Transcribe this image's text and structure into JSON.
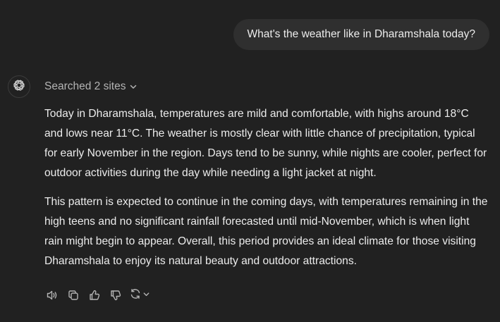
{
  "user_message": {
    "text": "What's the weather like in Dharamshala today?"
  },
  "assistant": {
    "avatar_icon": "openai-logo-icon",
    "searched": {
      "label": "Searched 2 sites",
      "icon": "chevron-down-icon"
    },
    "paragraphs": [
      "Today in Dharamshala, temperatures are mild and comfortable, with highs around 18°C and lows near 11°C. The weather is mostly clear with little chance of precipitation, typical for early November in the region. Days tend to be sunny, while nights are cooler, perfect for outdoor activities during the day while needing a light jacket at night.",
      "This pattern is expected to continue in the coming days, with temperatures remaining in the high teens and no significant rainfall forecasted until mid-November, which is when light rain might begin to appear. Overall, this period provides an ideal climate for those visiting Dharamshala to enjoy its natural beauty and outdoor attractions."
    ],
    "actions": [
      {
        "icon": "speaker-icon"
      },
      {
        "icon": "copy-icon"
      },
      {
        "icon": "thumbs-up-icon"
      },
      {
        "icon": "thumbs-down-icon"
      },
      {
        "icon": "regenerate-icon"
      }
    ]
  },
  "colors": {
    "background": "#212121",
    "user_bubble": "#2f2f2f",
    "text": "#ececec",
    "muted": "#b4b4b4"
  }
}
